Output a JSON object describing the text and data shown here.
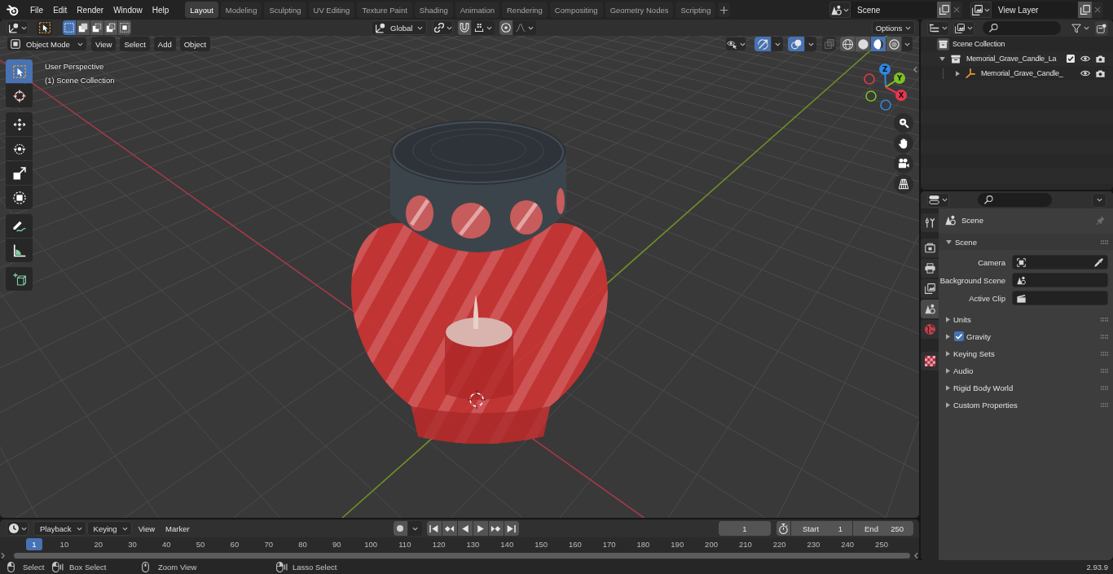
{
  "top_bar": {
    "menus": [
      "File",
      "Edit",
      "Render",
      "Window",
      "Help"
    ],
    "workspaces": [
      {
        "label": "Layout",
        "selected": true
      },
      {
        "label": "Modeling",
        "selected": false
      },
      {
        "label": "Sculpting",
        "selected": false
      },
      {
        "label": "UV Editing",
        "selected": false
      },
      {
        "label": "Texture Paint",
        "selected": false
      },
      {
        "label": "Shading",
        "selected": false
      },
      {
        "label": "Animation",
        "selected": false
      },
      {
        "label": "Rendering",
        "selected": false
      },
      {
        "label": "Compositing",
        "selected": false
      },
      {
        "label": "Geometry Nodes",
        "selected": false
      },
      {
        "label": "Scripting",
        "selected": false
      }
    ],
    "scene": "Scene",
    "view_layer": "View Layer"
  },
  "tool_header": {
    "select_modes": [
      {
        "selected": true
      },
      {
        "selected": false
      },
      {
        "selected": false
      },
      {
        "selected": false
      },
      {
        "selected": false
      }
    ],
    "orientation": "Global",
    "options": "Options"
  },
  "viewport_header": {
    "mode": "Object Mode",
    "menus": [
      "View",
      "Select",
      "Add",
      "Object"
    ],
    "gizmos_on": true,
    "overlays_on": true,
    "xray_on": false,
    "shading": [
      {
        "selected": false
      },
      {
        "selected": false
      },
      {
        "selected": true
      },
      {
        "selected": false
      }
    ]
  },
  "viewport": {
    "overlay_text": [
      "User Perspective",
      "(1) Scene Collection"
    ],
    "tools": [
      {
        "selected": true
      },
      {
        "selected": false
      },
      {
        "selected": false
      },
      {
        "selected": false
      },
      {
        "selected": false
      },
      {
        "selected": false
      },
      {
        "selected": false
      },
      {
        "selected": false
      },
      {
        "selected": false
      }
    ],
    "axes": [
      {
        "label": "Z",
        "color": "#2f86e4"
      },
      {
        "label": "Y",
        "color": "#7cc322"
      },
      {
        "label": "X",
        "color": "#e8364f"
      }
    ]
  },
  "outliner": {
    "tree": [
      {
        "label": "Scene Collection",
        "children": [
          {
            "label": "Memorial_Grave_Candle_La",
            "expanded": true,
            "checked": true,
            "children": [
              {
                "label": "Memorial_Grave_Candle_",
                "expanded": false
              }
            ]
          }
        ]
      }
    ]
  },
  "properties": {
    "tabs": [
      {
        "selected": false
      },
      {
        "selected": false
      },
      {
        "selected": false
      },
      {
        "selected": false
      },
      {
        "selected": true
      },
      {
        "selected": false
      },
      {
        "selected": false
      }
    ],
    "context": "Scene",
    "panels": [
      {
        "title": "Scene",
        "kind": "plain",
        "expanded": true,
        "fields": [
          {
            "label": "Camera"
          },
          {
            "label": "Background Scene"
          },
          {
            "label": "Active Clip"
          }
        ]
      },
      {
        "title": "Units",
        "kind": "plain",
        "expanded": false
      },
      {
        "title": "Gravity",
        "kind": "toggle",
        "checked": true,
        "expanded": false
      },
      {
        "title": "Keying Sets",
        "kind": "plain",
        "expanded": false
      },
      {
        "title": "Audio",
        "kind": "plain",
        "expanded": false
      },
      {
        "title": "Rigid Body World",
        "kind": "plain",
        "expanded": false
      },
      {
        "title": "Custom Properties",
        "kind": "plain",
        "expanded": false
      }
    ]
  },
  "timeline": {
    "menus": [
      {
        "label": "Playback",
        "kind": "dropdown"
      },
      {
        "label": "Keying",
        "kind": "dropdown"
      },
      {
        "label": "View",
        "kind": "menu"
      },
      {
        "label": "Marker",
        "kind": "menu"
      }
    ],
    "auto_keying": false,
    "current_frame": "1",
    "start_label": "Start",
    "start": "1",
    "end_label": "End",
    "end": "250",
    "playhead": "1",
    "ticks": [
      "10",
      "20",
      "30",
      "40",
      "50",
      "60",
      "70",
      "80",
      "90",
      "100",
      "110",
      "120",
      "130",
      "140",
      "150",
      "160",
      "170",
      "180",
      "190",
      "200",
      "210",
      "220",
      "230",
      "240",
      "250"
    ]
  },
  "status_bar": {
    "hints": [
      "Select",
      "Box Select",
      "Zoom View",
      "Lasso Select"
    ],
    "version": "2.93.9"
  }
}
